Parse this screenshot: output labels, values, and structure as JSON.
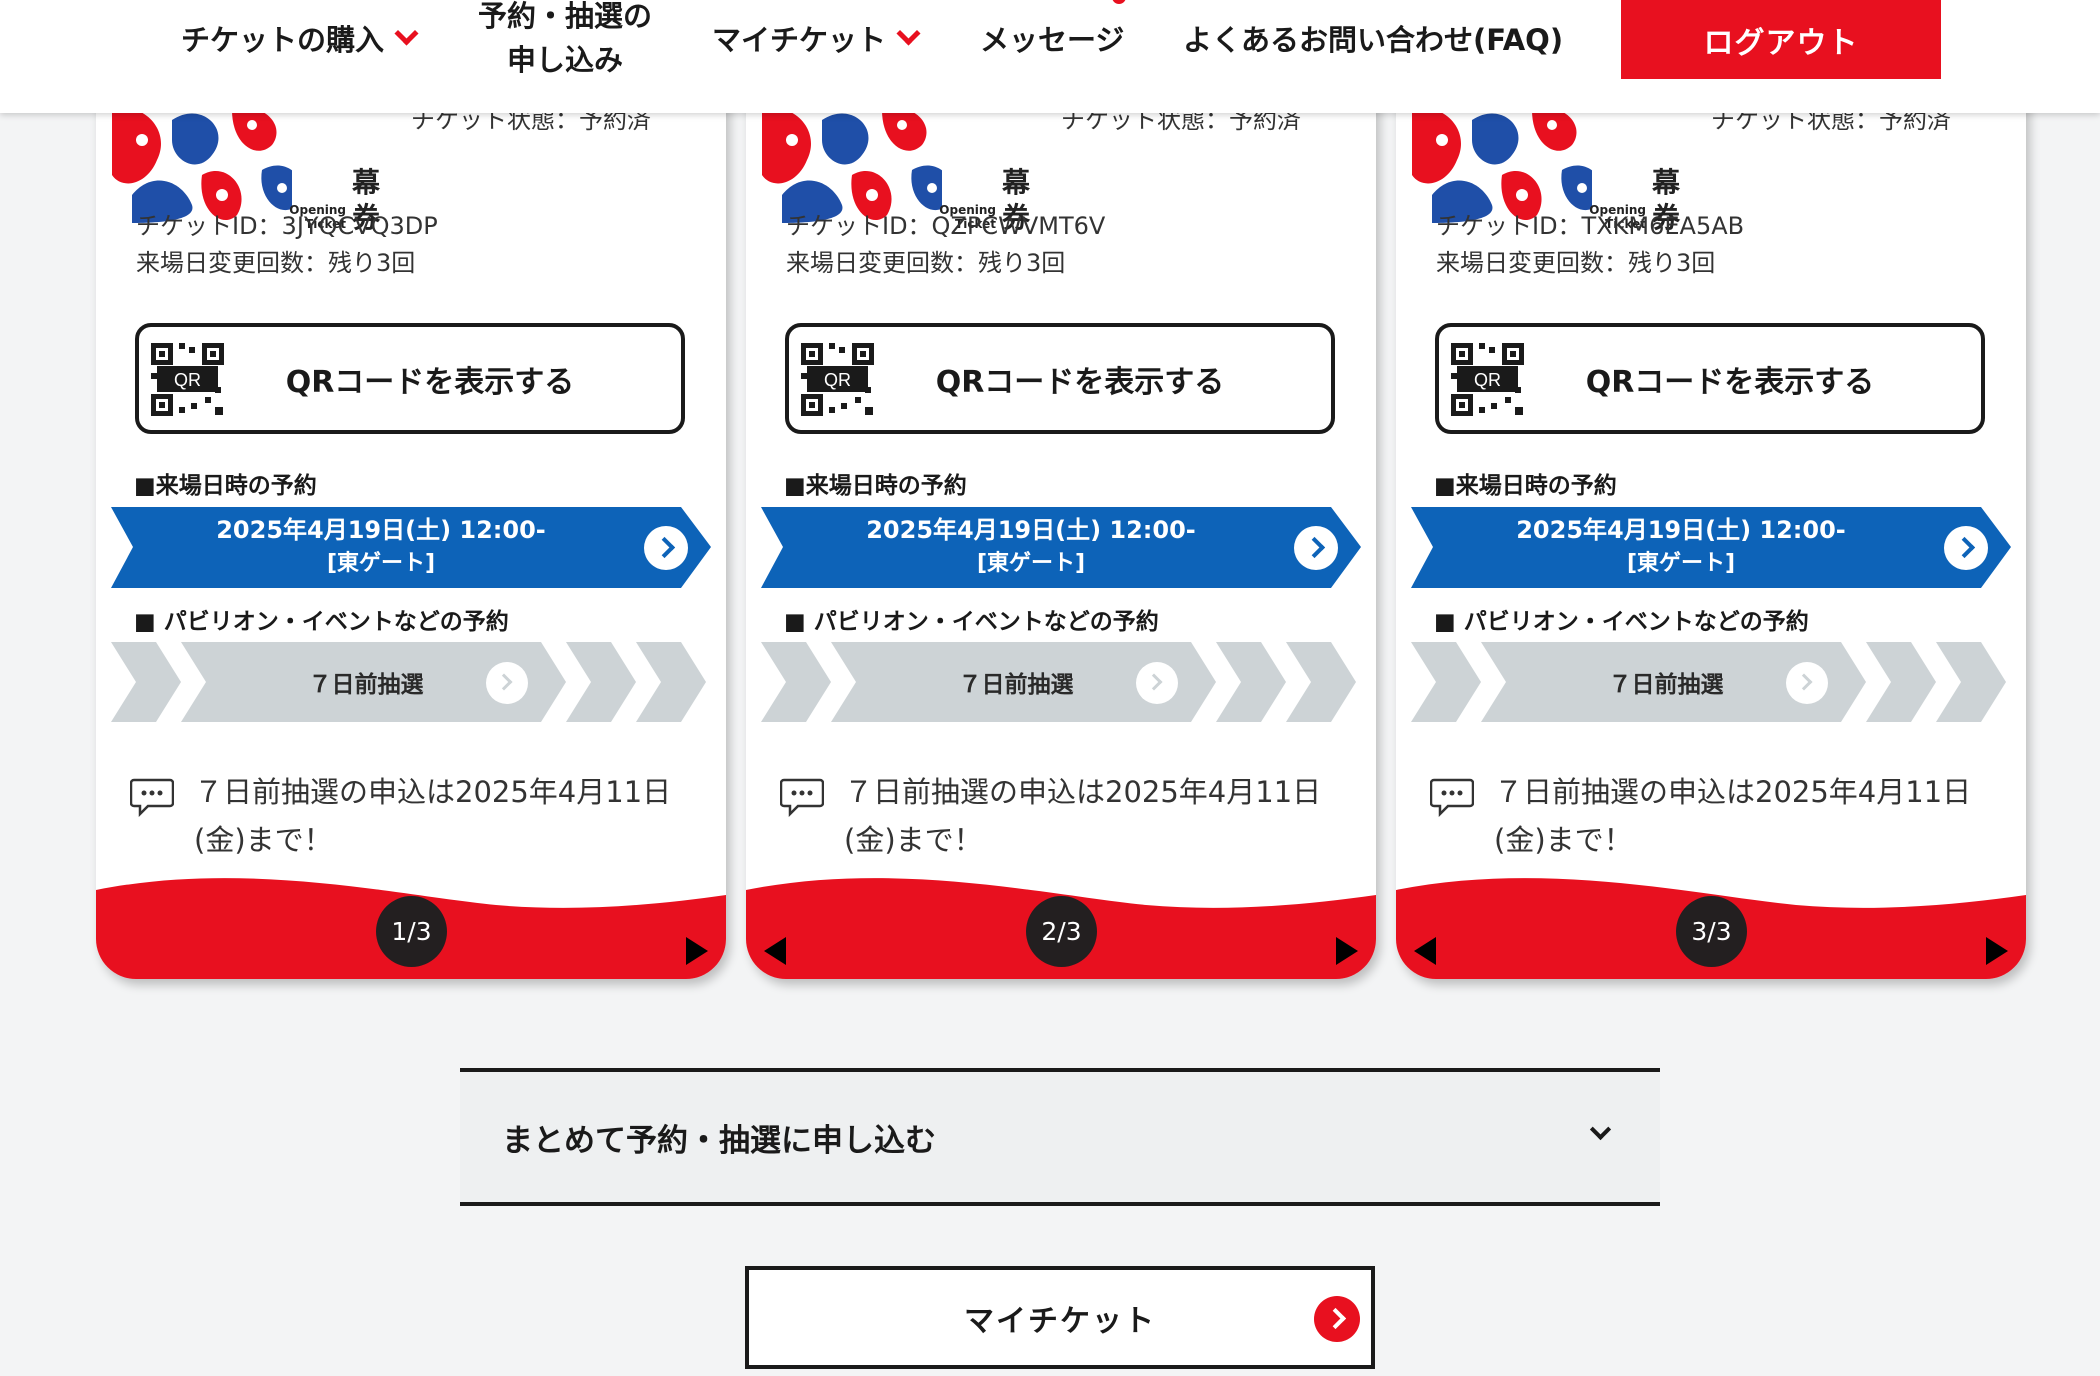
{
  "header": {
    "nav": [
      {
        "label": "チケットの購入"
      },
      {
        "label_line1": "予約・抽選の",
        "label_line2": "申し込み"
      },
      {
        "label": "マイチケット"
      },
      {
        "label": "メッセージ"
      },
      {
        "label": "よくあるお問い合わせ(FAQ)"
      }
    ],
    "logout_label": "ログアウト"
  },
  "cards": [
    {
      "status": "チケット状態：予約済",
      "art_label_en": "Opening Ticket",
      "art_label_jp_top": "幕",
      "art_label_jp": "券",
      "ticket_id": "チケットID：3JYQCVQ3DP",
      "change_count": "来場日変更回数：残り3回",
      "qr_label": "QRコードを表示する",
      "qr_icon_text": "QR",
      "visit_title": "■来場日時の予約",
      "visit_date": "2025年4月19日(土) 12:00-",
      "visit_gate": "[東ゲート]",
      "pavilion_title": "■ パビリオン・イベントなどの予約",
      "lottery_label": "７日前抽選",
      "notice": "７日前抽選の申込は2025年4月11日(金)まで！",
      "page": "1/3"
    },
    {
      "status": "チケット状態：予約済",
      "art_label_en": "Opening Ticket",
      "art_label_jp_top": "幕",
      "art_label_jp": "券",
      "ticket_id": "チケットID：QZPCWVMT6V",
      "change_count": "来場日変更回数：残り3回",
      "qr_label": "QRコードを表示する",
      "qr_icon_text": "QR",
      "visit_title": "■来場日時の予約",
      "visit_date": "2025年4月19日(土) 12:00-",
      "visit_gate": "[東ゲート]",
      "pavilion_title": "■ パビリオン・イベントなどの予約",
      "lottery_label": "７日前抽選",
      "notice": "７日前抽選の申込は2025年4月11日(金)まで！",
      "page": "2/3"
    },
    {
      "status": "チケット状態：予約済",
      "art_label_en": "Opening Ticket",
      "art_label_jp_top": "幕",
      "art_label_jp": "券",
      "ticket_id": "チケットID：TXKM6EA5AB",
      "change_count": "来場日変更回数：残り3回",
      "qr_label": "QRコードを表示する",
      "qr_icon_text": "QR",
      "visit_title": "■来場日時の予約",
      "visit_date": "2025年4月19日(土) 12:00-",
      "visit_gate": "[東ゲート]",
      "pavilion_title": "■ パビリオン・イベントなどの予約",
      "lottery_label": "７日前抽選",
      "notice": "７日前抽選の申込は2025年4月11日(金)まで！",
      "page": "3/3"
    }
  ],
  "bulk_label": "まとめて予約・抽選に申し込む",
  "myticket_label": "マイチケット",
  "colors": {
    "brand_red": "#e8101f",
    "visit_blue": "#0d63b8",
    "lottery_gray": "#cdd3d6",
    "badge_dark": "#231f20"
  }
}
